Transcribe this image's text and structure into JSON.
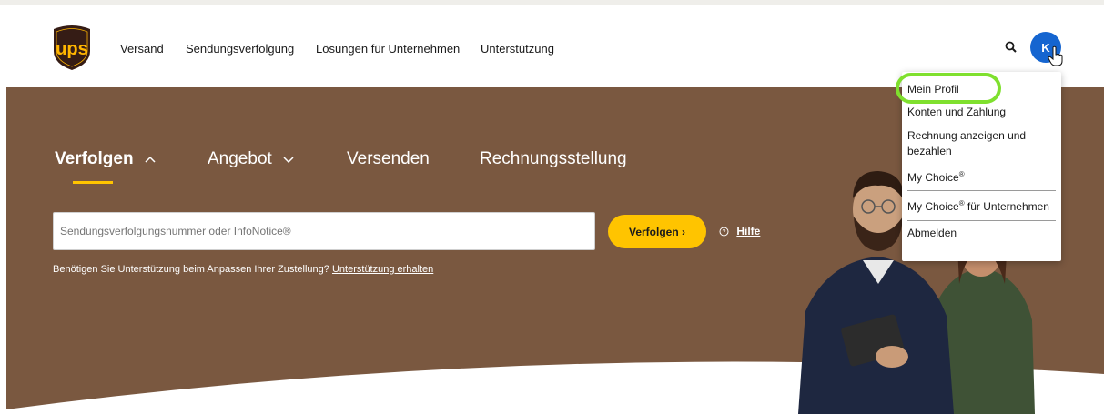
{
  "header": {
    "logo_text": "ups",
    "nav_items": [
      {
        "label": "Versand"
      },
      {
        "label": "Sendungsverfolgung"
      },
      {
        "label": "Lösungen für Unternehmen"
      },
      {
        "label": "Unterstützung"
      }
    ],
    "avatar_initial": "K"
  },
  "hero": {
    "tabs": [
      {
        "label": "Verfolgen",
        "icon": "chevron-up-icon",
        "active": true
      },
      {
        "label": "Angebot",
        "icon": "chevron-down-icon",
        "active": false
      },
      {
        "label": "Versenden",
        "active": false
      },
      {
        "label": "Rechnungsstellung",
        "active": false
      }
    ],
    "tracking": {
      "placeholder": "Sendungsverfolgungsnummer oder InfoNotice®",
      "value": "",
      "button_label": "Verfolgen ›",
      "help_label": "Hilfe"
    },
    "support_text": "Benötigen Sie Unterstützung beim Anpassen Ihrer Zustellung?",
    "support_link": "Unterstützung erhalten"
  },
  "profile_menu": {
    "items": [
      {
        "label": "Mein Profil",
        "highlighted": true
      },
      {
        "label": "Konten und Zahlung"
      },
      {
        "label": "Rechnung anzeigen und bezahlen"
      },
      {
        "label": "My Choice",
        "sup": "®"
      },
      {
        "label": "My Choice",
        "sup": "®",
        "suffix": " für Unternehmen"
      },
      {
        "label": "Abmelden"
      }
    ]
  },
  "colors": {
    "brand_brown": "#351c15",
    "brand_gold": "#ffb500",
    "hero_bg": "#7a5840",
    "accent_yellow": "#ffc400",
    "avatar_blue": "#1565d0",
    "highlight_green": "#7fe02e"
  }
}
